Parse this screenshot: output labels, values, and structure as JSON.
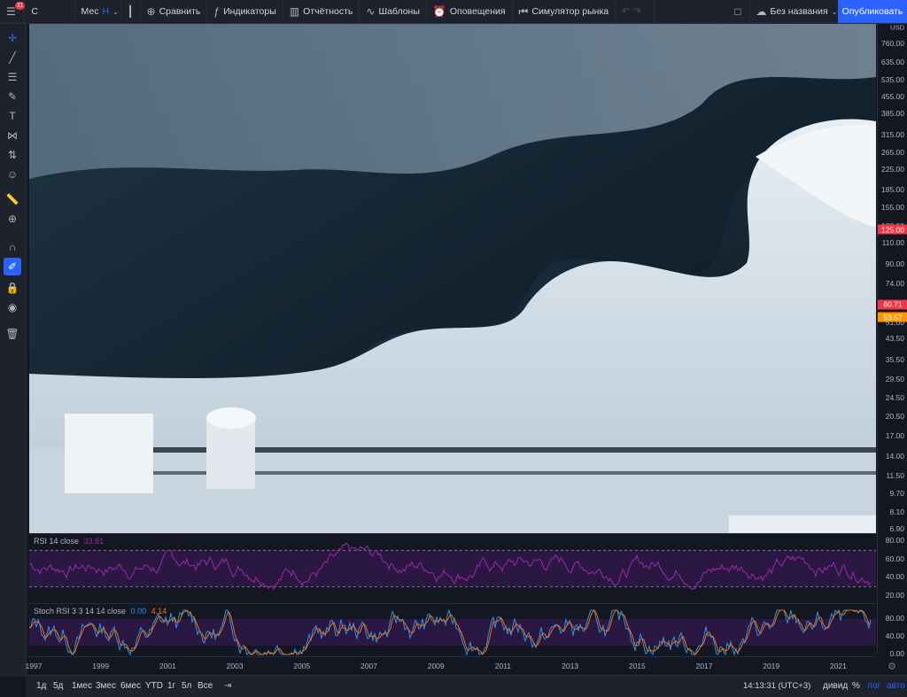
{
  "toolbar": {
    "menu_badge": "11",
    "symbol": "C",
    "interval": "Мес",
    "chart_type_letter": "H",
    "compare": "Сравнить",
    "indicators": "Индикаторы",
    "reports": "Отчётность",
    "templates": "Шаблоны",
    "alerts": "Оповещения",
    "replay": "Симулятор рынка",
    "layout_name": "Без названия",
    "publish": "Опубликовать"
  },
  "price_axis": {
    "currency": "USD",
    "ticks": [
      "760.00",
      "635.00",
      "535.00",
      "455.00",
      "385.00",
      "315.00",
      "265.00",
      "225.00",
      "185.00",
      "155.00",
      "130.00",
      "110.00",
      "90.00",
      "74.00",
      "61.00",
      "51.00",
      "43.50",
      "35.50",
      "29.50",
      "24.50",
      "20.50",
      "17.00",
      "14.00",
      "11.50",
      "9.70",
      "8.10",
      "6.90"
    ],
    "tags": [
      {
        "value": "125.00",
        "color": "#f23645"
      },
      {
        "value": "60.71",
        "color": "#f23645"
      },
      {
        "value": "53.57",
        "color": "#ff9800"
      }
    ]
  },
  "rsi": {
    "label": "RSI 14 close",
    "value": "33.81",
    "ticks": [
      "80.00",
      "60.00",
      "40.00",
      "20.00"
    ],
    "color": "#9c27b0",
    "upper": 70,
    "lower": 30
  },
  "stoch": {
    "label": "Stoch RSI 3 3 14 14 close",
    "k_value": "0.00",
    "d_value": "4.14",
    "ticks": [
      "80.00",
      "40.00",
      "0.00"
    ],
    "k_color": "#2196f3",
    "d_color": "#ff6d00",
    "upper": 80,
    "lower": 20
  },
  "time_axis": {
    "ticks": [
      "1997",
      "1999",
      "2001",
      "2003",
      "2005",
      "2007",
      "2009",
      "2011",
      "2013",
      "2015",
      "2017",
      "2019",
      "2021"
    ]
  },
  "bottom": {
    "ranges": [
      "1д",
      "5д",
      "1мес",
      "3мес",
      "6мес",
      "YTD",
      "1г",
      "5л",
      "Все"
    ],
    "clock": "14:13:31 (UTC+3)",
    "adj": "дивид",
    "percent": "%",
    "log": "лог",
    "auto": "авто"
  },
  "colors": {
    "accent": "#2962ff",
    "background": "#131722",
    "panel": "#1e222d"
  }
}
